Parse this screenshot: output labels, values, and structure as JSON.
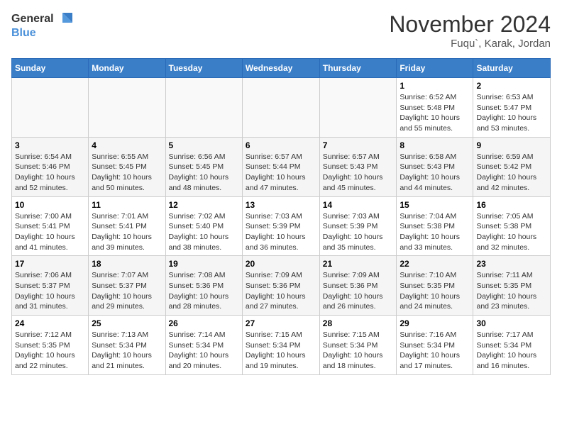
{
  "header": {
    "logo_line1": "General",
    "logo_line2": "Blue",
    "month_title": "November 2024",
    "location": "Fuqu`, Karak, Jordan"
  },
  "weekdays": [
    "Sunday",
    "Monday",
    "Tuesday",
    "Wednesday",
    "Thursday",
    "Friday",
    "Saturday"
  ],
  "weeks": [
    [
      {
        "day": "",
        "info": ""
      },
      {
        "day": "",
        "info": ""
      },
      {
        "day": "",
        "info": ""
      },
      {
        "day": "",
        "info": ""
      },
      {
        "day": "",
        "info": ""
      },
      {
        "day": "1",
        "info": "Sunrise: 6:52 AM\nSunset: 5:48 PM\nDaylight: 10 hours and 55 minutes."
      },
      {
        "day": "2",
        "info": "Sunrise: 6:53 AM\nSunset: 5:47 PM\nDaylight: 10 hours and 53 minutes."
      }
    ],
    [
      {
        "day": "3",
        "info": "Sunrise: 6:54 AM\nSunset: 5:46 PM\nDaylight: 10 hours and 52 minutes."
      },
      {
        "day": "4",
        "info": "Sunrise: 6:55 AM\nSunset: 5:45 PM\nDaylight: 10 hours and 50 minutes."
      },
      {
        "day": "5",
        "info": "Sunrise: 6:56 AM\nSunset: 5:45 PM\nDaylight: 10 hours and 48 minutes."
      },
      {
        "day": "6",
        "info": "Sunrise: 6:57 AM\nSunset: 5:44 PM\nDaylight: 10 hours and 47 minutes."
      },
      {
        "day": "7",
        "info": "Sunrise: 6:57 AM\nSunset: 5:43 PM\nDaylight: 10 hours and 45 minutes."
      },
      {
        "day": "8",
        "info": "Sunrise: 6:58 AM\nSunset: 5:43 PM\nDaylight: 10 hours and 44 minutes."
      },
      {
        "day": "9",
        "info": "Sunrise: 6:59 AM\nSunset: 5:42 PM\nDaylight: 10 hours and 42 minutes."
      }
    ],
    [
      {
        "day": "10",
        "info": "Sunrise: 7:00 AM\nSunset: 5:41 PM\nDaylight: 10 hours and 41 minutes."
      },
      {
        "day": "11",
        "info": "Sunrise: 7:01 AM\nSunset: 5:41 PM\nDaylight: 10 hours and 39 minutes."
      },
      {
        "day": "12",
        "info": "Sunrise: 7:02 AM\nSunset: 5:40 PM\nDaylight: 10 hours and 38 minutes."
      },
      {
        "day": "13",
        "info": "Sunrise: 7:03 AM\nSunset: 5:39 PM\nDaylight: 10 hours and 36 minutes."
      },
      {
        "day": "14",
        "info": "Sunrise: 7:03 AM\nSunset: 5:39 PM\nDaylight: 10 hours and 35 minutes."
      },
      {
        "day": "15",
        "info": "Sunrise: 7:04 AM\nSunset: 5:38 PM\nDaylight: 10 hours and 33 minutes."
      },
      {
        "day": "16",
        "info": "Sunrise: 7:05 AM\nSunset: 5:38 PM\nDaylight: 10 hours and 32 minutes."
      }
    ],
    [
      {
        "day": "17",
        "info": "Sunrise: 7:06 AM\nSunset: 5:37 PM\nDaylight: 10 hours and 31 minutes."
      },
      {
        "day": "18",
        "info": "Sunrise: 7:07 AM\nSunset: 5:37 PM\nDaylight: 10 hours and 29 minutes."
      },
      {
        "day": "19",
        "info": "Sunrise: 7:08 AM\nSunset: 5:36 PM\nDaylight: 10 hours and 28 minutes."
      },
      {
        "day": "20",
        "info": "Sunrise: 7:09 AM\nSunset: 5:36 PM\nDaylight: 10 hours and 27 minutes."
      },
      {
        "day": "21",
        "info": "Sunrise: 7:09 AM\nSunset: 5:36 PM\nDaylight: 10 hours and 26 minutes."
      },
      {
        "day": "22",
        "info": "Sunrise: 7:10 AM\nSunset: 5:35 PM\nDaylight: 10 hours and 24 minutes."
      },
      {
        "day": "23",
        "info": "Sunrise: 7:11 AM\nSunset: 5:35 PM\nDaylight: 10 hours and 23 minutes."
      }
    ],
    [
      {
        "day": "24",
        "info": "Sunrise: 7:12 AM\nSunset: 5:35 PM\nDaylight: 10 hours and 22 minutes."
      },
      {
        "day": "25",
        "info": "Sunrise: 7:13 AM\nSunset: 5:34 PM\nDaylight: 10 hours and 21 minutes."
      },
      {
        "day": "26",
        "info": "Sunrise: 7:14 AM\nSunset: 5:34 PM\nDaylight: 10 hours and 20 minutes."
      },
      {
        "day": "27",
        "info": "Sunrise: 7:15 AM\nSunset: 5:34 PM\nDaylight: 10 hours and 19 minutes."
      },
      {
        "day": "28",
        "info": "Sunrise: 7:15 AM\nSunset: 5:34 PM\nDaylight: 10 hours and 18 minutes."
      },
      {
        "day": "29",
        "info": "Sunrise: 7:16 AM\nSunset: 5:34 PM\nDaylight: 10 hours and 17 minutes."
      },
      {
        "day": "30",
        "info": "Sunrise: 7:17 AM\nSunset: 5:34 PM\nDaylight: 10 hours and 16 minutes."
      }
    ]
  ]
}
